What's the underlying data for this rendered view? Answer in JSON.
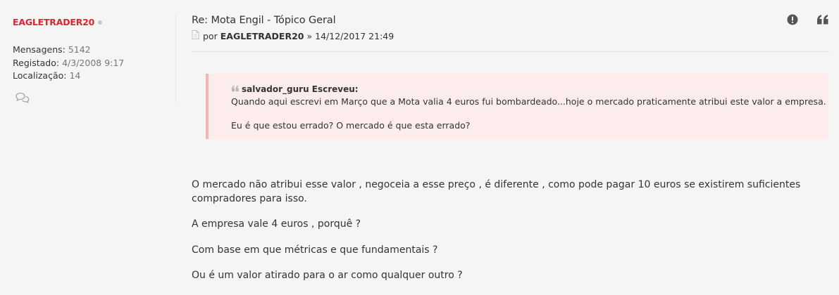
{
  "profile": {
    "username": "EAGLETRADER20",
    "details": [
      {
        "label": "Mensagens:",
        "value": "5142"
      },
      {
        "label": "Registado:",
        "value": "4/3/2008 9:17"
      },
      {
        "label": "Localização:",
        "value": "14"
      }
    ],
    "pm_icon": "chat-bubbles-icon",
    "online_dot_color": "#c8c8c8",
    "username_color": "#e0232d"
  },
  "post": {
    "title": "Re: Mota Engil - Tópico Geral",
    "meta": {
      "prefix": "por",
      "author": "EAGLETRADER20",
      "separator": "»",
      "datetime": "14/12/2017 21:49"
    },
    "actions": [
      {
        "name": "report-icon"
      },
      {
        "name": "quote-icon"
      }
    ],
    "quote": {
      "author_line": "salvador_guru Escreveu:",
      "lines": [
        "Quando aqui escrevi em Março que a Mota valia 4 euros fui bombardeado...hoje o mercado praticamente atribui este valor a empresa.",
        "Eu é que estou errado? O mercado é que esta errado?"
      ],
      "background": "#fcecec",
      "border_color": "#f4b5b5"
    },
    "body": [
      "O mercado não atribui esse valor , negoceia a esse preço , é diferente , como pode pagar 10 euros se existirem suficientes compradores para isso.",
      "A empresa vale 4 euros , porquê ?",
      "Com base em que métricas e que fundamentais ?",
      "Ou é um valor atirado para o ar como qualquer outro ?"
    ]
  }
}
